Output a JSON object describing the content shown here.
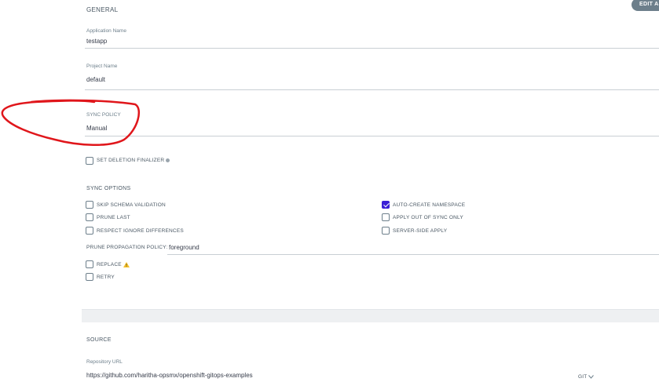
{
  "toolbar": {
    "edit_label": "EDIT AS"
  },
  "general": {
    "title": "GENERAL",
    "application_name": {
      "label": "Application Name",
      "value": "testapp"
    },
    "project_name": {
      "label": "Project Name",
      "value": "default"
    },
    "sync_policy": {
      "label": "SYNC POLICY",
      "value": "Manual"
    },
    "deletion_finalizer": {
      "label": "SET DELETION FINALIZER",
      "checked": false
    }
  },
  "sync_options": {
    "title": "SYNC OPTIONS",
    "left": [
      {
        "label": "SKIP SCHEMA VALIDATION",
        "checked": false
      },
      {
        "label": "PRUNE LAST",
        "checked": false
      },
      {
        "label": "RESPECT IGNORE DIFFERENCES",
        "checked": false
      }
    ],
    "right": [
      {
        "label": "AUTO-CREATE NAMESPACE",
        "checked": true
      },
      {
        "label": "APPLY OUT OF SYNC ONLY",
        "checked": false
      },
      {
        "label": "SERVER-SIDE APPLY",
        "checked": false
      }
    ],
    "prune_propagation": {
      "label": "PRUNE PROPAGATION POLICY:",
      "value": "foreground"
    },
    "replace": {
      "label": "REPLACE",
      "checked": false
    },
    "retry": {
      "label": "RETRY",
      "checked": false
    }
  },
  "source": {
    "title": "SOURCE",
    "repository_url": {
      "label": "Repository URL",
      "value": "https://github.com/haritha-opsmx/openshift-gitops-examples"
    },
    "repo_type": "GIT"
  },
  "colors": {
    "accent": "#3b1fd6",
    "annotation": "#e0161b",
    "warning": "#f4c030"
  }
}
